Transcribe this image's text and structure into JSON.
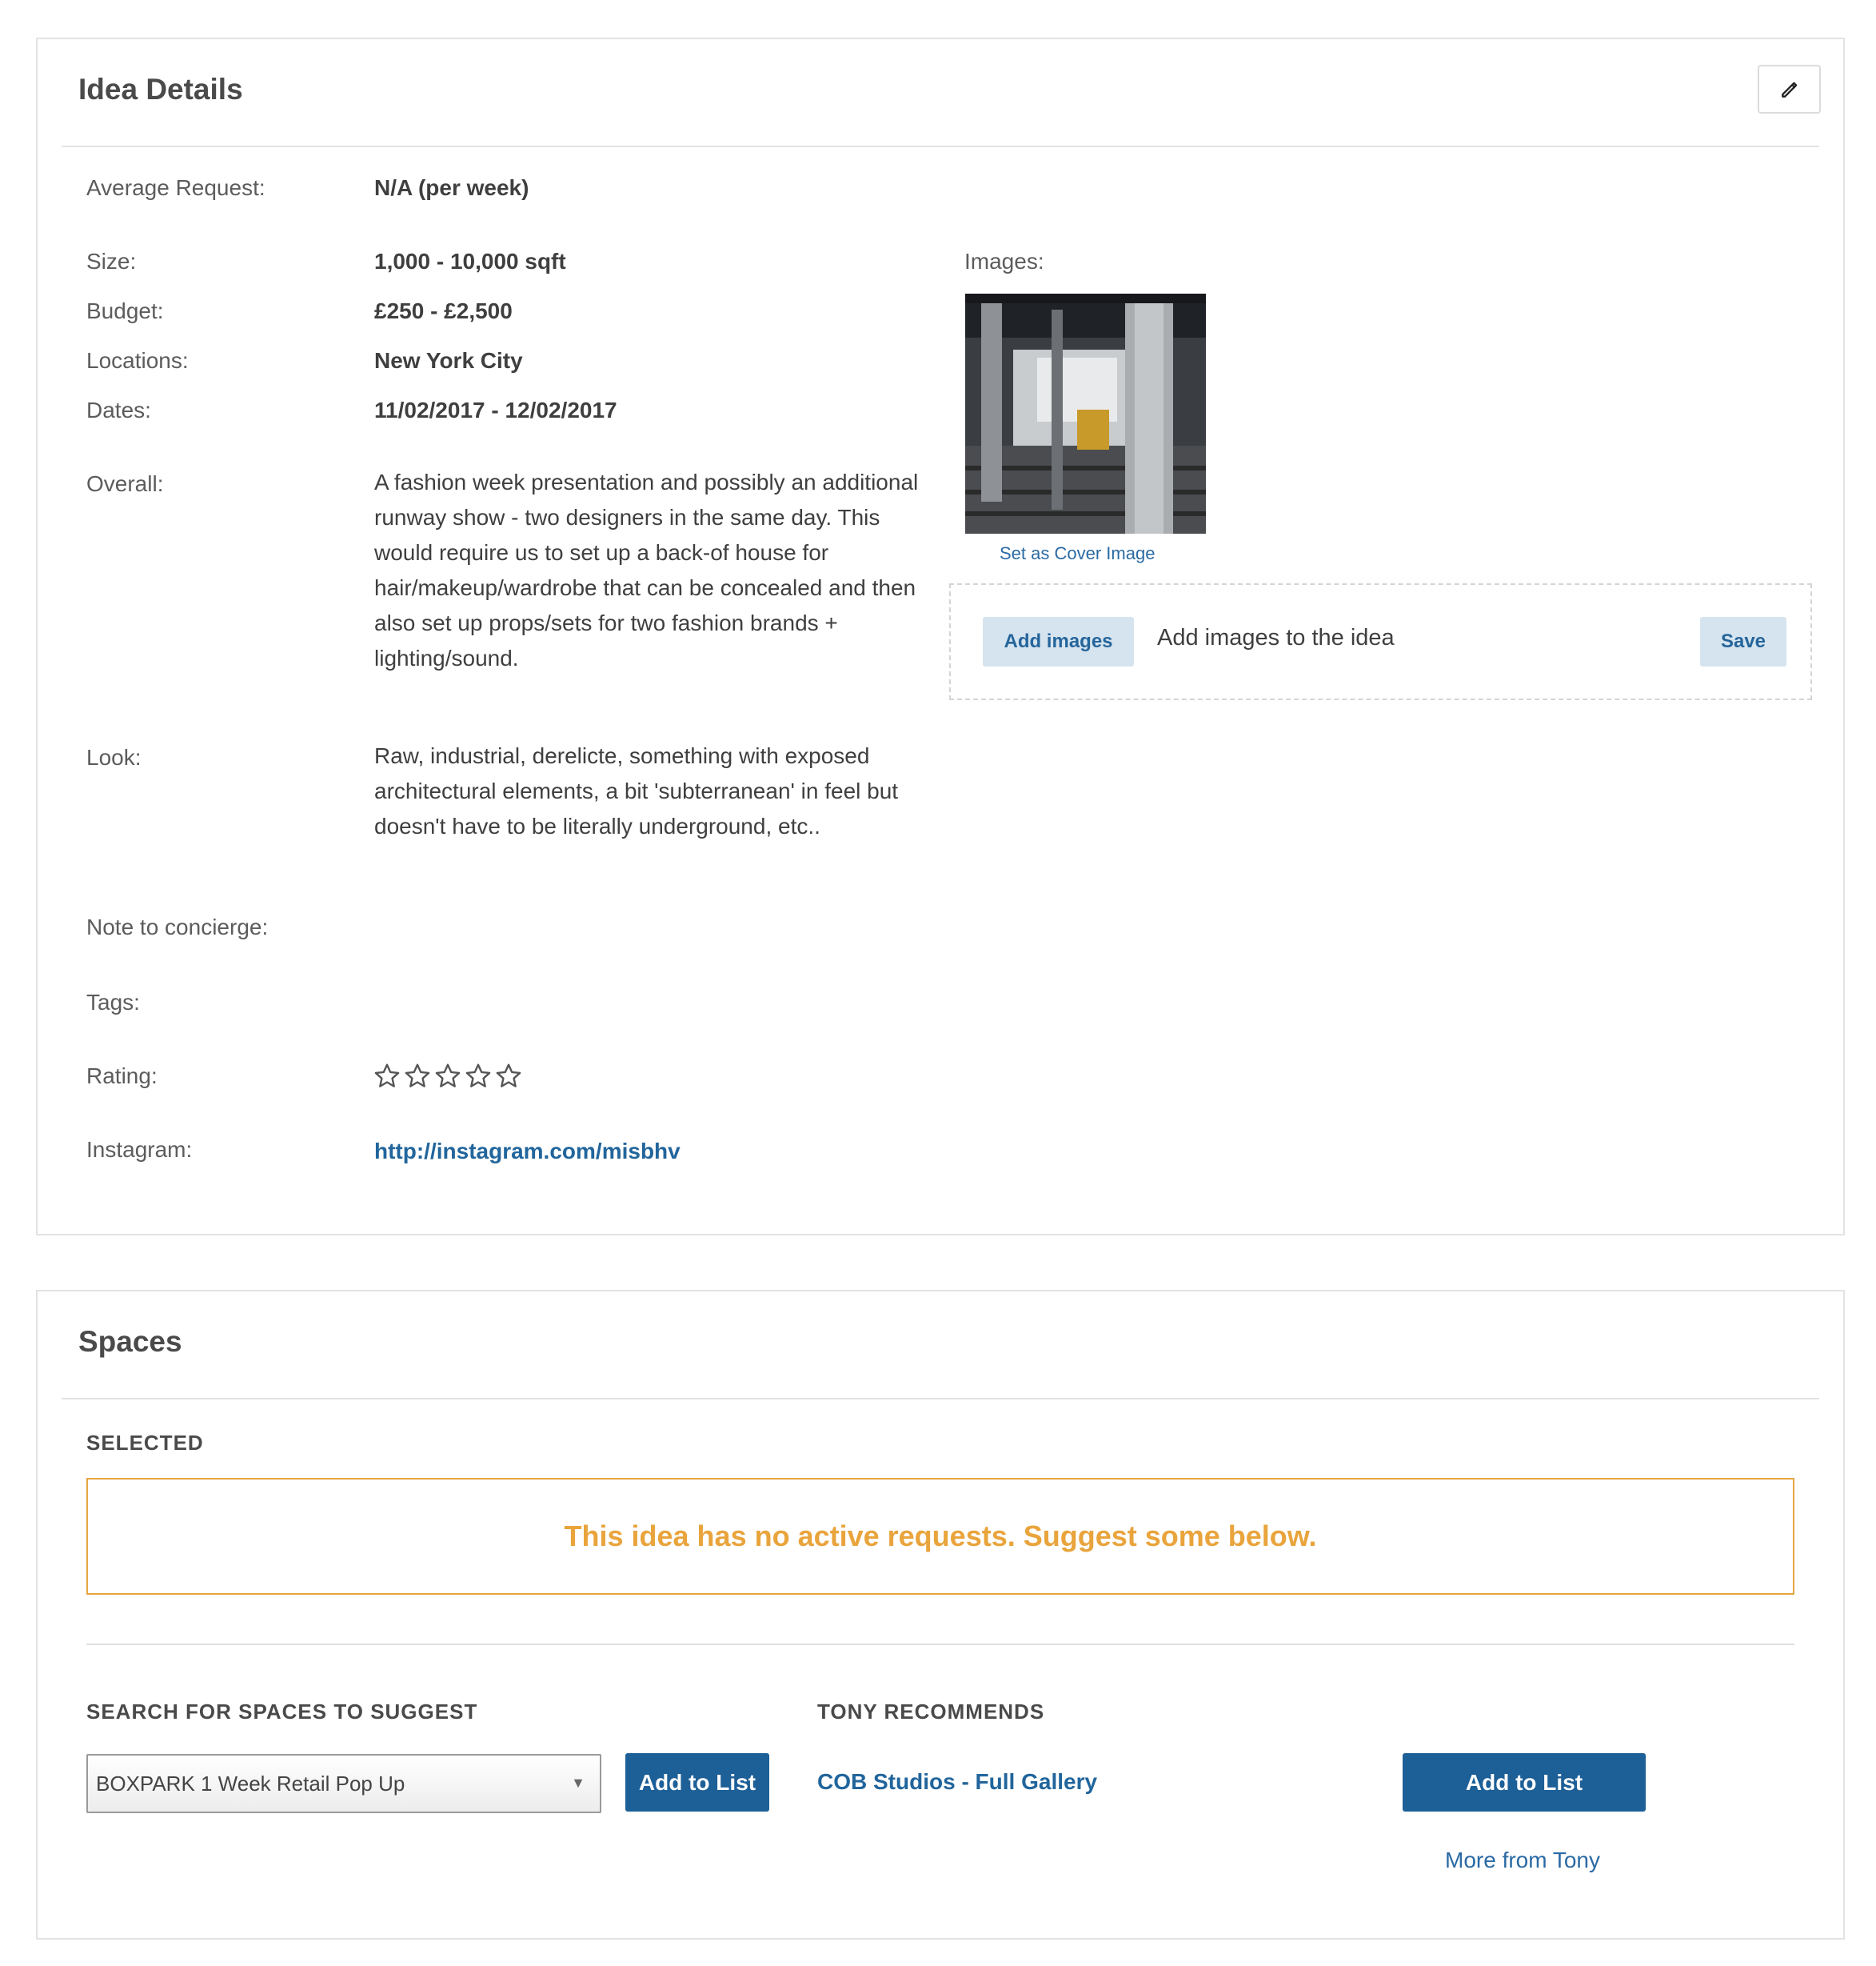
{
  "idea": {
    "title": "Idea Details",
    "edit_icon": "pencil-icon",
    "fields": {
      "average_request": {
        "label": "Average Request:",
        "value": "N/A (per week)"
      },
      "size": {
        "label": "Size:",
        "value": "1,000 - 10,000 sqft"
      },
      "budget": {
        "label": "Budget:",
        "value": "£250 - £2,500"
      },
      "locations": {
        "label": "Locations:",
        "value": "New York City"
      },
      "dates": {
        "label": "Dates:",
        "value": "11/02/2017 - 12/02/2017"
      },
      "overall": {
        "label": "Overall:",
        "value": "A fashion week presentation and possibly an additional runway show - two designers in the same day. This would require us to set up a back-of house for hair/makeup/wardrobe that can be concealed and then also set up props/sets for two fashion brands + lighting/sound."
      },
      "look": {
        "label": "Look:",
        "value": "Raw, industrial, derelicte, something with exposed architectural elements, a bit 'subterranean' in feel but doesn't have to be literally underground, etc.."
      },
      "note": {
        "label": "Note to concierge:",
        "value": ""
      },
      "tags": {
        "label": "Tags:",
        "value": ""
      },
      "rating": {
        "label": "Rating:",
        "value": 0,
        "max": 5
      },
      "instagram": {
        "label": "Instagram:",
        "value": "http://instagram.com/misbhv"
      }
    },
    "images": {
      "label": "Images:",
      "set_cover": "Set as Cover Image",
      "add_button": "Add images",
      "hint": "Add images to the idea",
      "save_button": "Save"
    }
  },
  "spaces": {
    "title": "Spaces",
    "selected_header": "SELECTED",
    "notice": "This idea has no active requests. Suggest some below.",
    "search_header": "SEARCH FOR SPACES TO SUGGEST",
    "search_value": "BOXPARK 1 Week Retail Pop Up",
    "add_to_list": "Add to List",
    "recommend_header": "TONY RECOMMENDS",
    "recommendation": "COB Studios - Full Gallery",
    "recommend_add": "Add to List",
    "more_link": "More from Tony"
  },
  "colors": {
    "accent_blue": "#1d5f97",
    "link_blue": "#21659c",
    "notice_orange": "#e9a43c",
    "border": "#e3e3e3"
  }
}
